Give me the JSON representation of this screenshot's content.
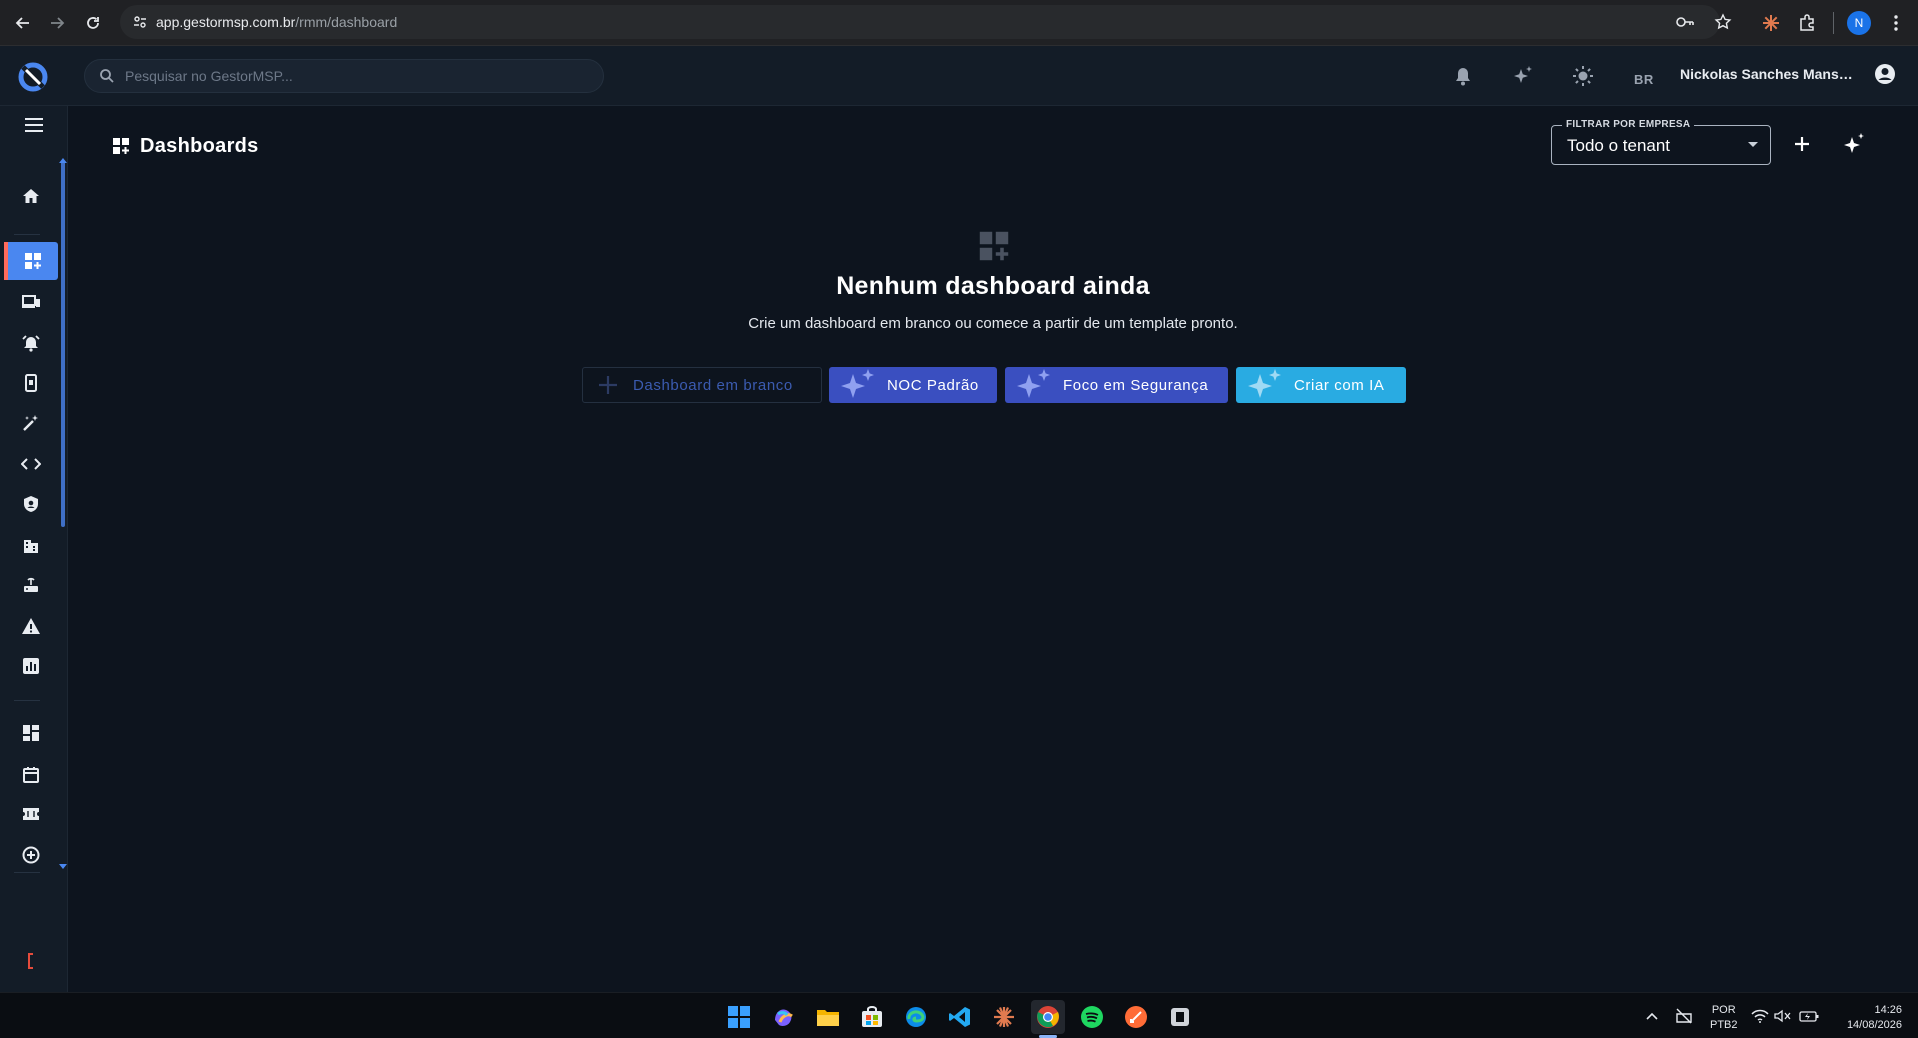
{
  "browser": {
    "url_host": "app.gestormsp.com.br",
    "url_path": "/rmm/dashboard",
    "profile_initial": "N"
  },
  "topbar": {
    "search_placeholder": "Pesquisar no GestorMSP...",
    "locale": "BR",
    "user_name": "Nickolas Sanches Mansa..."
  },
  "sidebar": {
    "items": [
      {
        "icon": "home-icon",
        "active": false
      },
      {
        "icon": "dashboard-add-icon",
        "active": true
      },
      {
        "icon": "devices-icon",
        "active": false
      },
      {
        "icon": "alarm-icon",
        "active": false
      },
      {
        "icon": "mobile-icon",
        "active": false
      },
      {
        "icon": "magic-wand-icon",
        "active": false
      },
      {
        "icon": "code-icon",
        "active": false
      },
      {
        "icon": "shield-icon",
        "active": false
      },
      {
        "icon": "building-icon",
        "active": false
      },
      {
        "icon": "router-icon",
        "active": false
      },
      {
        "icon": "warning-icon",
        "active": false
      },
      {
        "icon": "report-icon",
        "active": false
      },
      {
        "icon": "dashboard-icon",
        "active": false
      },
      {
        "icon": "calendar-icon",
        "active": false
      },
      {
        "icon": "ticket-icon",
        "active": false
      },
      {
        "icon": "add-circle-icon",
        "active": false
      }
    ]
  },
  "header": {
    "title": "Dashboards",
    "filter_label": "FILTRAR POR EMPRESA",
    "filter_value": "Todo o tenant"
  },
  "empty_state": {
    "title": "Nenhum dashboard ainda",
    "subtitle": "Crie um dashboard em branco ou comece a partir de um template pronto."
  },
  "actions": {
    "blank_label": "Dashboard em branco",
    "noc_label": "NOC Padrão",
    "security_label": "Foco em Segurança",
    "ai_label": "Criar com IA"
  },
  "taskbar": {
    "lang_line1": "POR",
    "lang_line2": "PTB2",
    "time": "14:26",
    "date": "14/08/2026"
  },
  "colors": {
    "accent": "#4a87f0",
    "primary_button": "#3a4fc0",
    "ai_button": "#29abe2",
    "background": "#0d141e"
  }
}
